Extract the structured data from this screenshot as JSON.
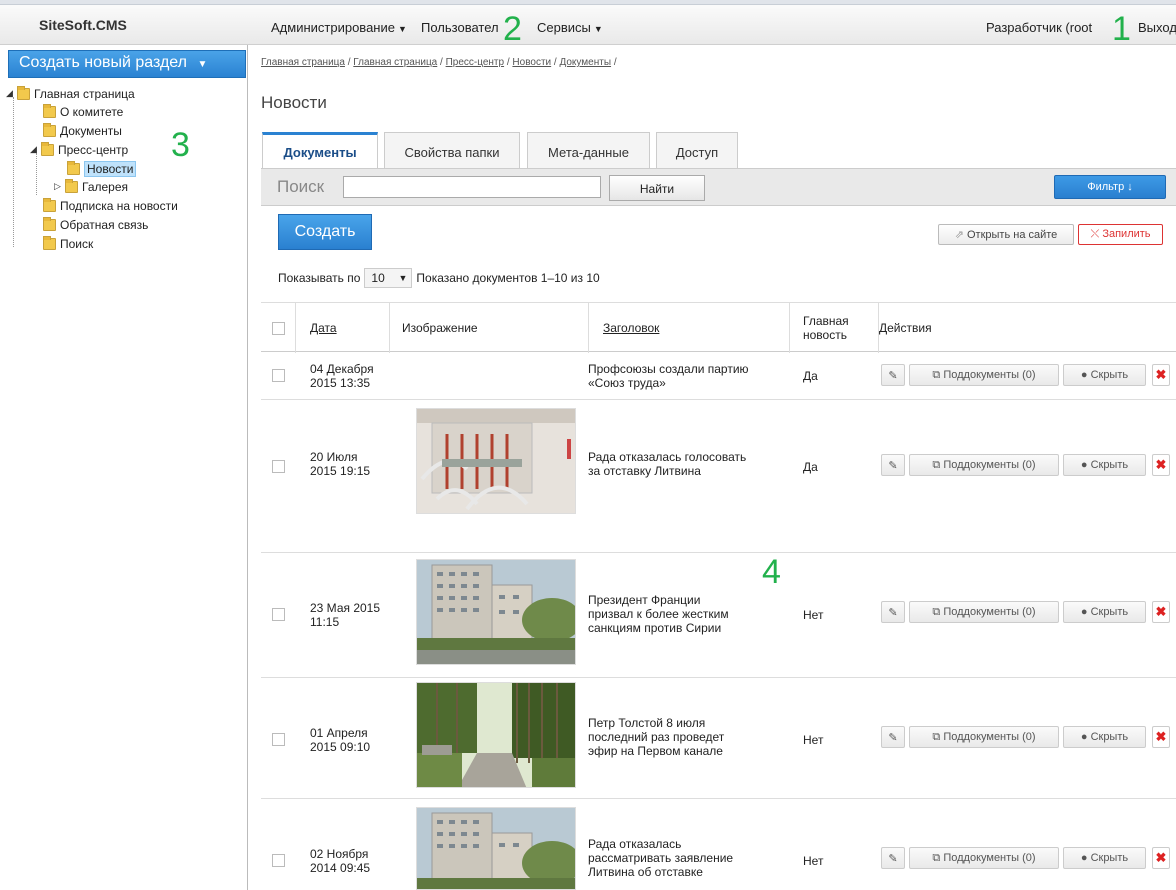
{
  "app": {
    "logo": "SiteSoft.CMS"
  },
  "topmenu": {
    "admin": "Администрирование",
    "users": "Пользовател",
    "services": "Сервисы",
    "user": "Разработчик (root",
    "logout": "Выход"
  },
  "markers": [
    "1",
    "2",
    "3",
    "4"
  ],
  "sidebar": {
    "create_label": "Создать новый раздел",
    "tree": [
      {
        "label": "Главная страница"
      },
      {
        "label": "О комитете"
      },
      {
        "label": "Документы"
      },
      {
        "label": "Пресс-центр"
      },
      {
        "label": "Новости"
      },
      {
        "label": "Галерея"
      },
      {
        "label": "Подписка на новости"
      },
      {
        "label": "Обратная связь"
      },
      {
        "label": "Поиск"
      }
    ]
  },
  "breadcrumb": [
    "Главная страница",
    "Главная страница",
    "Пресс-центр",
    "Новости",
    "Документы"
  ],
  "page_title": "Новости",
  "tabs": [
    {
      "label": "Документы",
      "active": true
    },
    {
      "label": "Свойства папки"
    },
    {
      "label": "Мета-данные"
    },
    {
      "label": "Доступ"
    }
  ],
  "search": {
    "label": "Поиск",
    "value": "",
    "find_label": "Найти",
    "filter_label": "Фильтр ↓"
  },
  "toolbar": {
    "create_label": "Создать",
    "open_site_label": "Открыть на сайте",
    "pin_label": "Запилить"
  },
  "paging": {
    "show_label": "Показывать по",
    "per_page": "10",
    "summary": "Показано документов 1–10 из 10"
  },
  "table": {
    "headers": {
      "date": "Дата",
      "image": "Изображение",
      "title": "Заголовок",
      "main_line1": "Главная",
      "main_line2": "новость",
      "actions": "Действия"
    },
    "actions": {
      "subdocs": "Поддокументы (0)",
      "hide": "Скрыть"
    },
    "rows": [
      {
        "date1": "04 Декабря",
        "date2": "2015 13:35",
        "title": [
          "Профсоюзы создали партию",
          "«Союз труда»",
          ""
        ],
        "main": "Да",
        "image": "none"
      },
      {
        "date1": "20 Июля",
        "date2": "2015 19:15",
        "title": [
          "Рада отказалась голосовать",
          "за отставку Литвина",
          ""
        ],
        "main": "Да",
        "image": "boiler"
      },
      {
        "date1": "23 Мая 2015",
        "date2": "11:15",
        "title": [
          "Президент Франции",
          "призвал к более жестким",
          "санкциям против Сирии"
        ],
        "main": "Нет",
        "image": "buildings"
      },
      {
        "date1": "01 Апреля",
        "date2": "2015 09:10",
        "title": [
          "Петр Толстой 8 июля",
          "последний раз проведет",
          "эфир на Первом канале"
        ],
        "main": "Нет",
        "image": "forest"
      },
      {
        "date1": "02 Ноября",
        "date2": "2014 09:45",
        "title": [
          "Рада отказалась",
          "рассматривать заявление",
          "Литвина об отставке"
        ],
        "main": "Нет",
        "image": "buildings"
      }
    ]
  }
}
